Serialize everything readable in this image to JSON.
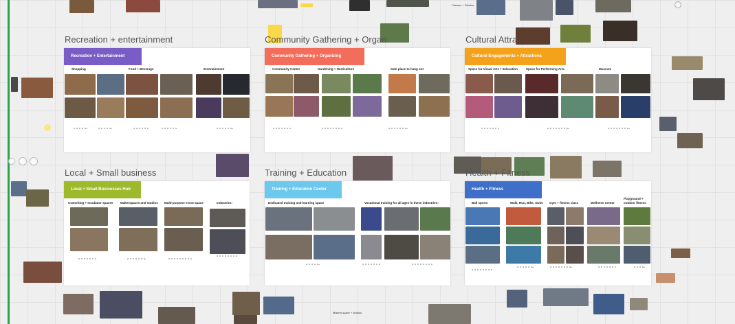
{
  "canvas": {
    "sections": [
      {
        "title": "Recreation + entertainment",
        "banner": "Recreation + Entertainment",
        "color": "#7a5cc6",
        "columns": [
          "Shopping",
          "Food + Beverage",
          "Entertainment"
        ]
      },
      {
        "title": "Community Gathering + Organ",
        "banner": "Community Gathering + Organizing",
        "color": "#f26d5b",
        "columns": [
          "Community Center",
          "Gardening + Horticulture",
          "Safe place to hang out"
        ]
      },
      {
        "title": "Cultural Attra",
        "banner": "Cultural Engagements + Attractions",
        "color": "#f4a21b",
        "columns": [
          "Space for Visual Arts + Education",
          "Space for Performing Arts",
          "Museum"
        ]
      },
      {
        "title": "Local + Small business",
        "banner": "Local + Small Businesses Hub",
        "color": "#9db92c",
        "columns": [
          "Coworking + Incubator spaces",
          "Makerspaces and studios",
          "Multi-purpose event space",
          "Industries:"
        ]
      },
      {
        "title": "Training + Education",
        "banner": "Training + Education Center",
        "color": "#6cc8ec",
        "columns": [
          "Dedicated training and learning space",
          "Vocational training for all ages in these industries:"
        ]
      },
      {
        "title": "Health + Fitness",
        "banner": "Health + Fitness",
        "color": "#3f6fc9",
        "columns": [
          "Ball sports",
          "Walk, Run, Bike, Swim",
          "Gym + fitness class",
          "Wellness Center",
          "Playground + outdoor fitness"
        ]
      }
    ],
    "floating_labels": {
      "classes_studios": "Classes + Studios",
      "makers_space": "Makers space + studios"
    },
    "colors": {
      "rail": "#2aa44a",
      "sticky": "#f9d84a"
    }
  }
}
